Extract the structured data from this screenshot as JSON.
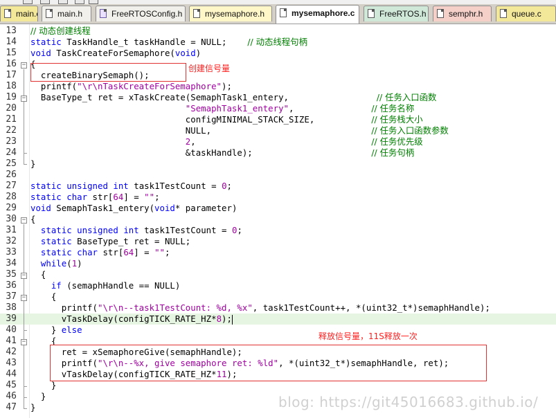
{
  "tabs": [
    {
      "label": "main.c",
      "kind": "c"
    },
    {
      "label": "main.h",
      "kind": "h"
    },
    {
      "label": "FreeRTOSConfig.h",
      "kind": "h"
    },
    {
      "label": "mysemaphore.h",
      "kind": "hy"
    },
    {
      "label": "mysemaphore.c",
      "kind": "c",
      "active": true
    },
    {
      "label": "FreeRTOS.h",
      "kind": "hg"
    },
    {
      "label": "semphr.h",
      "kind": "hr"
    },
    {
      "label": "queue.c",
      "kind": "c"
    }
  ],
  "editor": {
    "lines": [
      {
        "n": "13",
        "code": "// 动态创建线程"
      },
      {
        "n": "14",
        "code": "static TaskHandle_t taskHandle = NULL;    // 动态线程句柄"
      },
      {
        "n": "15",
        "code": "void TaskCreateForSemaphore(void)"
      },
      {
        "n": "16",
        "code": "{"
      },
      {
        "n": "17",
        "code": "  createBinarySemaph();"
      },
      {
        "n": "18",
        "code": "  printf(\"\\r\\nTaskCreateForSemaphore\");"
      },
      {
        "n": "19",
        "code": "  BaseType_t ret = xTaskCreate(SemaphTask1_entery,                 // 任务入口函数"
      },
      {
        "n": "20",
        "code": "                              \"SemaphTask1_entery\",               // 任务名称"
      },
      {
        "n": "21",
        "code": "                              configMINIMAL_STACK_SIZE,           // 任务栈大小"
      },
      {
        "n": "22",
        "code": "                              NULL,                               // 任务入口函数参数"
      },
      {
        "n": "23",
        "code": "                              2,                                  // 任务优先级"
      },
      {
        "n": "24",
        "code": "                              &taskHandle);                       // 任务句柄"
      },
      {
        "n": "25",
        "code": "}"
      },
      {
        "n": "26",
        "code": ""
      },
      {
        "n": "27",
        "code": "static unsigned int task1TestCount = 0;"
      },
      {
        "n": "28",
        "code": "static char str[64] = \"\";"
      },
      {
        "n": "29",
        "code": "void SemaphTask1_entery(void* parameter)"
      },
      {
        "n": "30",
        "code": "{"
      },
      {
        "n": "31",
        "code": "  static unsigned int task1TestCount = 0;"
      },
      {
        "n": "32",
        "code": "  static BaseType_t ret = NULL;"
      },
      {
        "n": "33",
        "code": "  static char str[64] = \"\";"
      },
      {
        "n": "34",
        "code": "  while(1)"
      },
      {
        "n": "35",
        "code": "  {"
      },
      {
        "n": "36",
        "code": "    if (semaphHandle == NULL)"
      },
      {
        "n": "37",
        "code": "    {"
      },
      {
        "n": "38",
        "code": "      printf(\"\\r\\n--task1TestCount: %d, %x\", task1TestCount++, *(uint32_t*)semaphHandle);"
      },
      {
        "n": "39",
        "code": "      vTaskDelay(configTICK_RATE_HZ*8);"
      },
      {
        "n": "40",
        "code": "    } else"
      },
      {
        "n": "41",
        "code": "    {"
      },
      {
        "n": "42",
        "code": "      ret = xSemaphoreGive(semaphHandle);"
      },
      {
        "n": "43",
        "code": "      printf(\"\\r\\n--%x, give semaphore ret: %ld\", *(uint32_t*)semaphHandle, ret);"
      },
      {
        "n": "44",
        "code": "      vTaskDelay(configTICK_RATE_HZ*11);"
      },
      {
        "n": "45",
        "code": "    }"
      },
      {
        "n": "46",
        "code": "  }"
      },
      {
        "n": "47",
        "code": "}"
      }
    ]
  },
  "annotations": {
    "create_label": "创建信号量",
    "give_label": "释放信号量，11S释放一次"
  },
  "watermark": "blog: https://git45016683.github.io/",
  "colors": {
    "keyword": "#0000ff",
    "string": "#a000a0",
    "comment": "#008000",
    "annotation": "#e03030",
    "current_line": "#e6f5e1"
  }
}
